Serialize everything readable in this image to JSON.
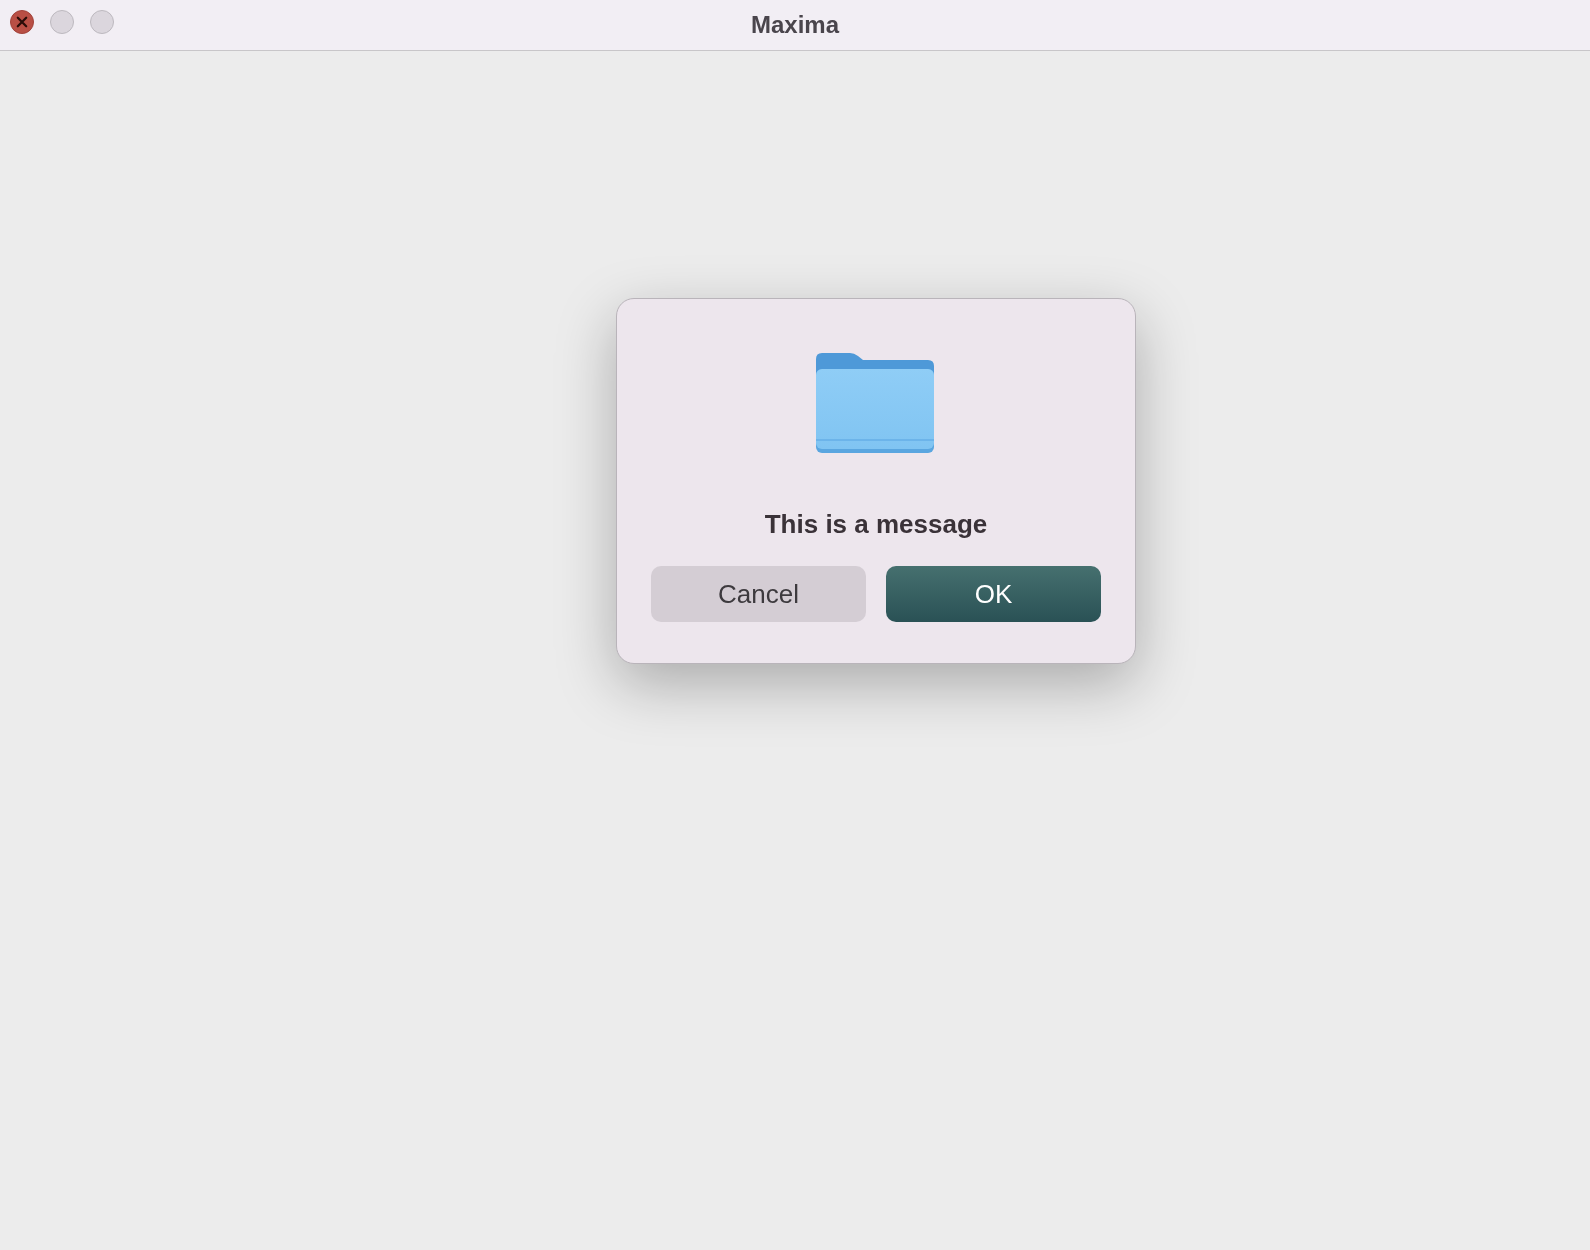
{
  "window": {
    "title": "Maxima",
    "controls": [
      {
        "kind": "close",
        "disabled": false
      },
      {
        "kind": "minimize",
        "disabled": true
      },
      {
        "kind": "zoom",
        "disabled": true
      }
    ]
  },
  "dialog": {
    "message": "This is a message",
    "buttons": [
      {
        "label": "Cancel",
        "kind": "normal"
      },
      {
        "label": "OK",
        "kind": "default"
      }
    ]
  }
}
